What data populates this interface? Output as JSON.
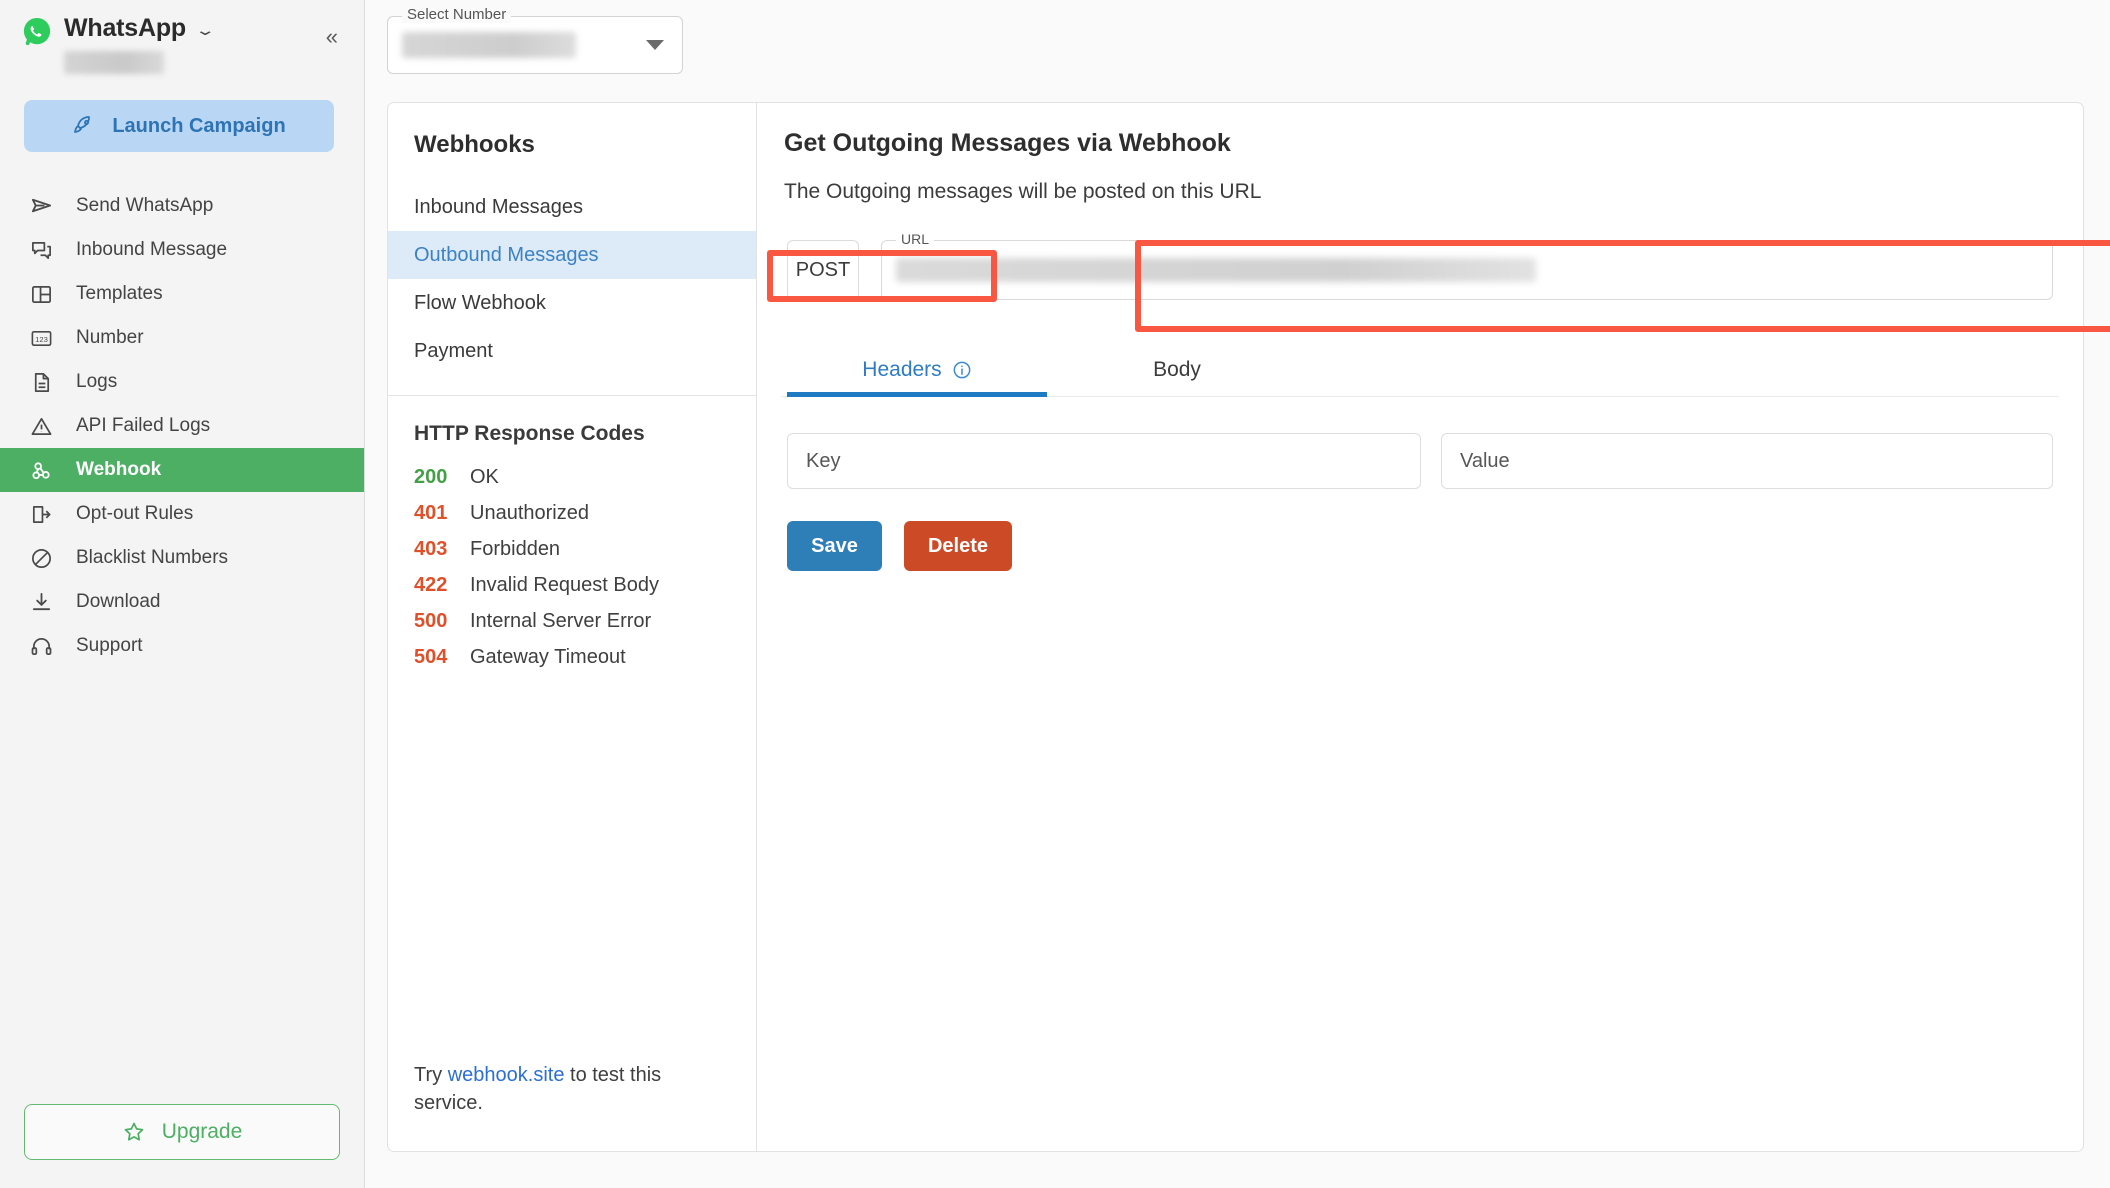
{
  "sidebar": {
    "brand": {
      "title": "WhatsApp",
      "logo_icon": "whatsapp-icon",
      "dropdown_icon": "chevron-down-icon"
    },
    "collapse_icon": "«",
    "launch_campaign": {
      "label": "Launch Campaign",
      "icon": "rocket-icon",
      "bg": "#b9d7f5",
      "fg": "#2e74b5"
    },
    "items": [
      {
        "label": "Send WhatsApp",
        "icon": "send-icon",
        "active": false
      },
      {
        "label": "Inbound Message",
        "icon": "chat-bubbles-icon",
        "active": false
      },
      {
        "label": "Templates",
        "icon": "layout-panels-icon",
        "active": false
      },
      {
        "label": "Number",
        "icon": "numeric-123-icon",
        "active": false
      },
      {
        "label": "Logs",
        "icon": "document-lines-icon",
        "active": false
      },
      {
        "label": "API Failed Logs",
        "icon": "warning-triangle-icon",
        "active": false
      },
      {
        "label": "Webhook",
        "icon": "webhook-icon",
        "active": true
      },
      {
        "label": "Opt-out Rules",
        "icon": "logout-arrow-icon",
        "active": false
      },
      {
        "label": "Blacklist Numbers",
        "icon": "block-circle-icon",
        "active": false
      },
      {
        "label": "Download",
        "icon": "download-icon",
        "active": false
      },
      {
        "label": "Support",
        "icon": "headset-icon",
        "active": false
      }
    ],
    "active_color": "#4caf63",
    "upgrade": {
      "label": "Upgrade",
      "icon": "star-icon",
      "color": "#4caf63"
    }
  },
  "topbar": {
    "select_number": {
      "legend": "Select Number",
      "value": "",
      "caret_icon": "caret-down-icon"
    }
  },
  "webhooks_panel": {
    "title": "Webhooks",
    "items": [
      {
        "label": "Inbound Messages",
        "selected": false
      },
      {
        "label": "Outbound Messages",
        "selected": true
      },
      {
        "label": "Flow Webhook",
        "selected": false
      },
      {
        "label": "Payment",
        "selected": false
      }
    ],
    "codes_title": "HTTP Response Codes",
    "codes": [
      {
        "code": "200",
        "label": "OK",
        "kind": "ok"
      },
      {
        "code": "401",
        "label": "Unauthorized",
        "kind": "err"
      },
      {
        "code": "403",
        "label": "Forbidden",
        "kind": "err"
      },
      {
        "code": "422",
        "label": "Invalid Request Body",
        "kind": "err"
      },
      {
        "code": "500",
        "label": "Internal Server Error",
        "kind": "err"
      },
      {
        "code": "504",
        "label": "Gateway Timeout",
        "kind": "err"
      }
    ],
    "footer": {
      "prefix": "Try ",
      "link": "webhook.site",
      "suffix": " to test this service."
    }
  },
  "detail": {
    "title": "Get Outgoing Messages via Webhook",
    "subtitle": "The Outgoing messages will be posted on this URL",
    "method": "POST",
    "url_legend": "URL",
    "url_value": "",
    "tabs": [
      {
        "label": "Headers",
        "active": true,
        "icon": "info-circle-icon"
      },
      {
        "label": "Body",
        "active": false,
        "icon": ""
      }
    ],
    "key_placeholder": "Key",
    "value_placeholder": "Value",
    "save_label": "Save",
    "delete_label": "Delete",
    "save_color": "#2e7eb8",
    "delete_color": "#cc4a26",
    "tab_accent": "#1f7ac4"
  },
  "annotations": {
    "color": "#fa5742",
    "boxes": [
      "outbound-messages-item",
      "url-input-row"
    ]
  }
}
